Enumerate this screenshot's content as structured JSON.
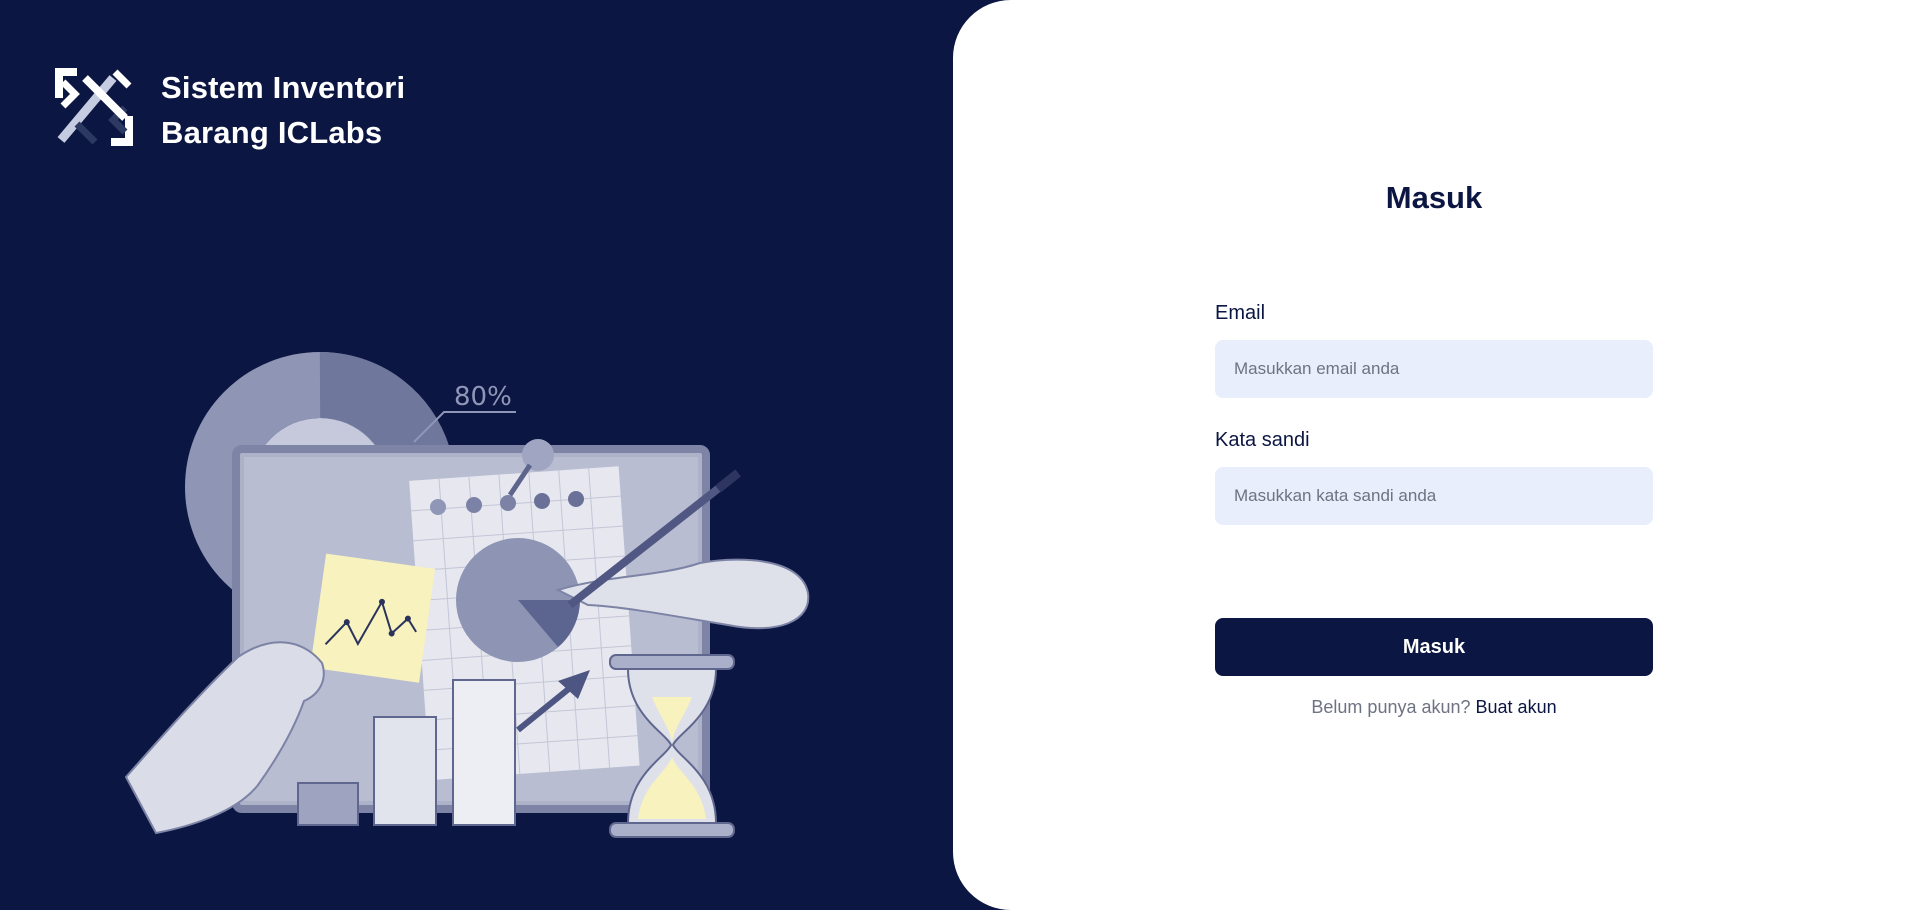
{
  "brand": {
    "logo_icon": "iclabs-logo-icon",
    "title_line1": "Sistem Inventori",
    "title_line2": "Barang ICLabs"
  },
  "illustration": {
    "icon": "inventory-analytics-illustration",
    "percent_label": "80%"
  },
  "login": {
    "title": "Masuk",
    "email_label": "Email",
    "email_placeholder": "Masukkan email anda",
    "email_value": "",
    "password_label": "Kata sandi",
    "password_placeholder": "Masukkan kata sandi anda",
    "password_value": "",
    "submit_label": "Masuk",
    "register_prompt": "Belum punya akun?",
    "register_link": "Buat akun"
  },
  "colors": {
    "navy": "#0c1642",
    "input_bg": "#e8eefc",
    "white": "#ffffff",
    "muted_text": "#6d7383",
    "highlight_yellow": "#f7f2be"
  }
}
